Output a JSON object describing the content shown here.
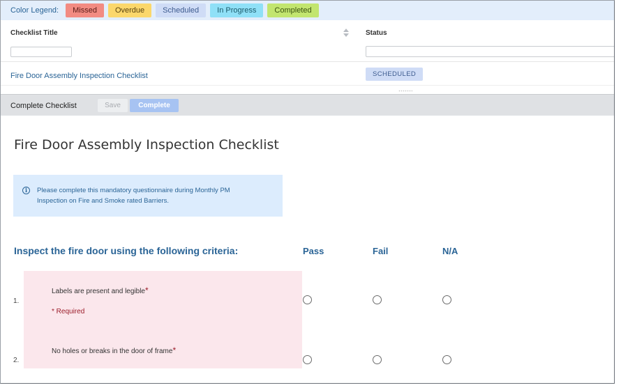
{
  "legend": {
    "label": "Color Legend:",
    "items": [
      {
        "label": "Missed",
        "bg": "#f28b82",
        "fg": "#5a1a16"
      },
      {
        "label": "Overdue",
        "bg": "#fbd76b",
        "fg": "#5a4410"
      },
      {
        "label": "Scheduled",
        "bg": "#cfdcf6",
        "fg": "#3d5b8f"
      },
      {
        "label": "In Progress",
        "bg": "#8fe0f7",
        "fg": "#1b5a6b"
      },
      {
        "label": "Completed",
        "bg": "#c2e56f",
        "fg": "#3a5310"
      }
    ]
  },
  "grid": {
    "columns": {
      "title": "Checklist Title",
      "status": "Status"
    },
    "rows": [
      {
        "title": "Fire Door Assembly Inspection Checklist",
        "status": "SCHEDULED"
      }
    ]
  },
  "toolbar": {
    "title": "Complete Checklist",
    "save_label": "Save",
    "complete_label": "Complete"
  },
  "form": {
    "title": "Fire Door Assembly Inspection Checklist",
    "info_icon": "info-icon",
    "info_text": "Please complete this mandatory questionnaire during Monthly PM Inspection on Fire and Smoke rated Barriers.",
    "section_title": "Inspect the fire door using the following criteria:",
    "options": [
      "Pass",
      "Fail",
      "N/A"
    ],
    "required_text": "* Required",
    "questions": [
      {
        "number": "1.",
        "text": "Labels are present and legible",
        "star": "*"
      },
      {
        "number": "2.",
        "text": "No holes or breaks in the door of frame",
        "star": "*"
      }
    ]
  },
  "colors": {
    "accent": "#2a6496",
    "legend_bg": "#e3eefb",
    "question_bg": "#fbe7ec",
    "info_bg": "#dcecfd",
    "required": "#9b1d2a"
  }
}
